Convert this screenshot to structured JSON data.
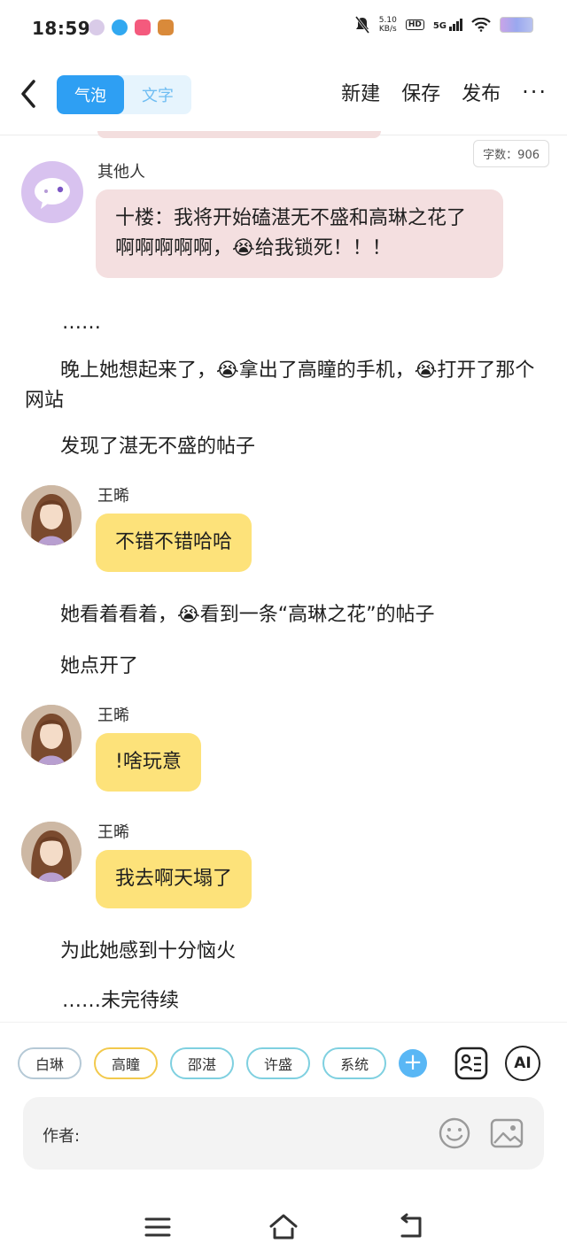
{
  "status_bar": {
    "time": "18:59",
    "net_speed_value": "5.10",
    "net_speed_unit": "KB/s",
    "hd": "HD",
    "signal": "5G"
  },
  "toolbar": {
    "tab_bubble": "气泡",
    "tab_text": "文字",
    "new_label": "新建",
    "save_label": "保存",
    "publish_label": "发布",
    "more_label": "···"
  },
  "word_count": "字数：906",
  "messages": [
    {
      "type": "chat",
      "speaker": "其他人",
      "text": "十楼：我将开始磕湛无不盛和高琳之花了啊啊啊啊啊，😭给我锁死！！！"
    },
    {
      "type": "narration",
      "text": "……"
    },
    {
      "type": "narration",
      "text": "晚上她想起来了，😭拿出了高瞳的手机，😭打开了那个网站"
    },
    {
      "type": "narration",
      "text": "发现了湛无不盛的帖子"
    },
    {
      "type": "chat",
      "speaker": "王晞",
      "text": "不错不错哈哈"
    },
    {
      "type": "narration",
      "text": "她看着看着，😭看到一条“高琳之花”的帖子"
    },
    {
      "type": "narration",
      "text": "她点开了"
    },
    {
      "type": "chat",
      "speaker": "王晞",
      "text": "!啥玩意"
    },
    {
      "type": "chat",
      "speaker": "王晞",
      "text": "我去啊天塌了"
    },
    {
      "type": "narration",
      "text": "为此她感到十分恼火"
    },
    {
      "type": "narration",
      "text": "……未完待续"
    }
  ],
  "characters": [
    "白琳",
    "高瞳",
    "邵湛",
    "许盛",
    "系统"
  ],
  "input": {
    "label": "作者:"
  },
  "icons": {
    "back": "chevron-left-icon",
    "add": "plus-icon",
    "profile": "profile-card-icon",
    "ai": "ai-icon",
    "emoji": "smiley-icon",
    "image": "image-icon",
    "menu": "menu-icon",
    "home": "home-icon",
    "return": "return-icon"
  },
  "ai_label": "AI",
  "colors": {
    "accent": "#2e9ff3",
    "pink_bubble": "#f4dfe0",
    "yellow_bubble": "#fde27a"
  }
}
